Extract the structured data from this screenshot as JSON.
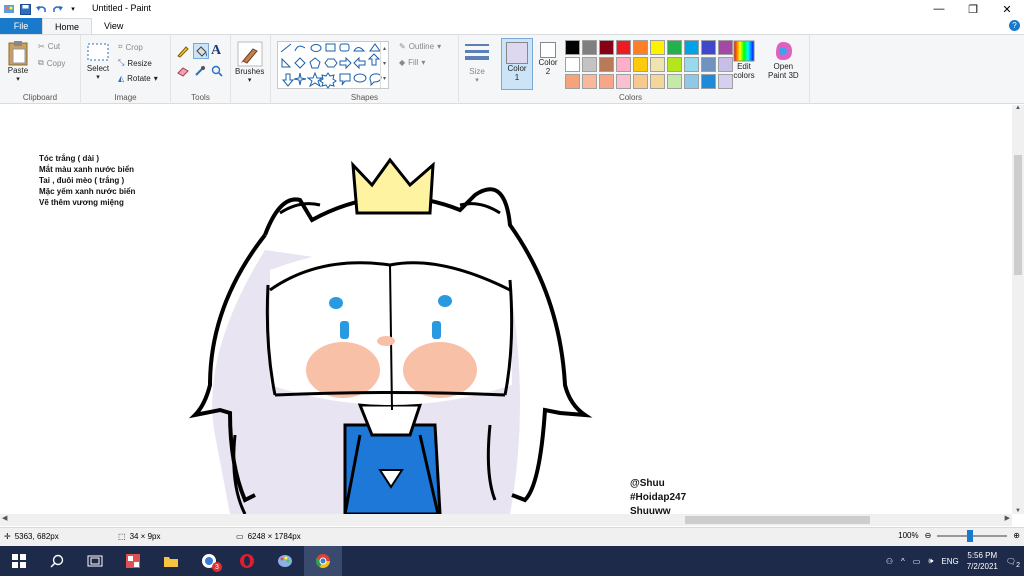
{
  "window": {
    "title": "Untitled - Paint"
  },
  "tabs": {
    "file": "File",
    "home": "Home",
    "view": "View"
  },
  "clipboard": {
    "paste": "Paste",
    "cut": "Cut",
    "copy": "Copy",
    "label": "Clipboard"
  },
  "image": {
    "select": "Select",
    "crop": "Crop",
    "resize": "Resize",
    "rotate": "Rotate",
    "label": "Image"
  },
  "tools": {
    "label": "Tools"
  },
  "brushes": {
    "label": "Brushes"
  },
  "shapes": {
    "outline": "Outline",
    "fill": "Fill",
    "label": "Shapes"
  },
  "size": {
    "label": "Size"
  },
  "colors": {
    "color1": "Color\n1",
    "color1_a": "Color",
    "color1_b": "1",
    "color2_a": "Color",
    "color2_b": "2",
    "edit_a": "Edit",
    "edit_b": "colors",
    "paint3d_a": "Open",
    "paint3d_b": "Paint 3D",
    "label": "Colors",
    "palette": [
      "#000000",
      "#7f7f7f",
      "#880015",
      "#ed1c24",
      "#ff7f27",
      "#fff200",
      "#22b14c",
      "#00a2e8",
      "#3f48cc",
      "#a349a4",
      "#ffffff",
      "#c3c3c3",
      "#b97a57",
      "#ffaec9",
      "#ffc90e",
      "#efe4b0",
      "#b5e61d",
      "#99d9ea",
      "#7092be",
      "#c8bfe7",
      "#f5a37a",
      "#f9b899",
      "#f8a58a",
      "#f8c0d0",
      "#f6c98e",
      "#f3d79a",
      "#c6e8a8",
      "#8fc9e8",
      "#1e8ad8",
      "#d6cff0"
    ]
  },
  "canvas": {
    "notes": [
      "Tóc trắng ( dài )",
      "Mắt màu xanh nước biển",
      "Tai , đuôi mèo ( trắng )",
      "Mặc yếm xanh nước biển",
      "Vẽ thêm vương miệng"
    ],
    "credit": [
      "@Shuu",
      "#Hoidap247",
      "Shuuww"
    ]
  },
  "status": {
    "cursor": "5363, 682px",
    "selection": "34 × 9px",
    "image_size": "6248 × 1784px",
    "zoom": "100%"
  },
  "taskbar": {
    "lang": "ENG",
    "time": "5:56 PM",
    "date": "7/2/2021",
    "notif": "2",
    "badge": "3"
  }
}
